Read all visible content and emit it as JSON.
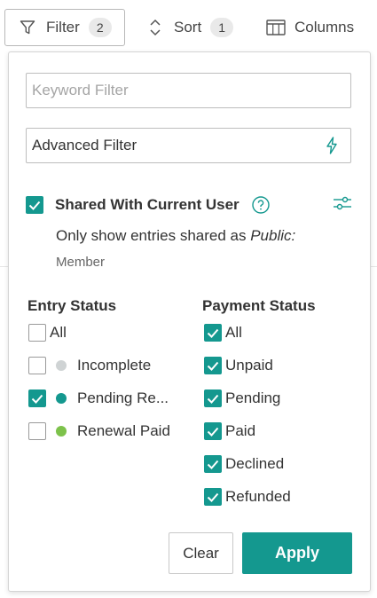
{
  "toolbar": {
    "filter_label": "Filter",
    "filter_count": "2",
    "sort_label": "Sort",
    "sort_count": "1",
    "columns_label": "Columns"
  },
  "panel": {
    "keyword_placeholder": "Keyword Filter",
    "keyword_value": "",
    "advanced_label": "Advanced Filter",
    "shared": {
      "checked": true,
      "label": "Shared With Current User",
      "description_prefix": "Only show entries shared as ",
      "description_emph": "Public:",
      "role": "Member"
    },
    "entry_status": {
      "title": "Entry Status",
      "options": [
        {
          "label": "All",
          "checked": false,
          "dot": null
        },
        {
          "label": "Incomplete",
          "checked": false,
          "dot": "#cfd3d4"
        },
        {
          "label": "Pending Re...",
          "checked": true,
          "dot": "#14988f"
        },
        {
          "label": "Renewal Paid",
          "checked": false,
          "dot": "#7dc24b"
        }
      ]
    },
    "payment_status": {
      "title": "Payment Status",
      "options": [
        {
          "label": "All",
          "checked": true
        },
        {
          "label": "Unpaid",
          "checked": true
        },
        {
          "label": "Pending",
          "checked": true
        },
        {
          "label": "Paid",
          "checked": true
        },
        {
          "label": "Declined",
          "checked": true
        },
        {
          "label": "Refunded",
          "checked": true
        }
      ]
    },
    "clear_label": "Clear",
    "apply_label": "Apply"
  },
  "colors": {
    "accent": "#14988f",
    "icon_teal": "#14988f"
  }
}
